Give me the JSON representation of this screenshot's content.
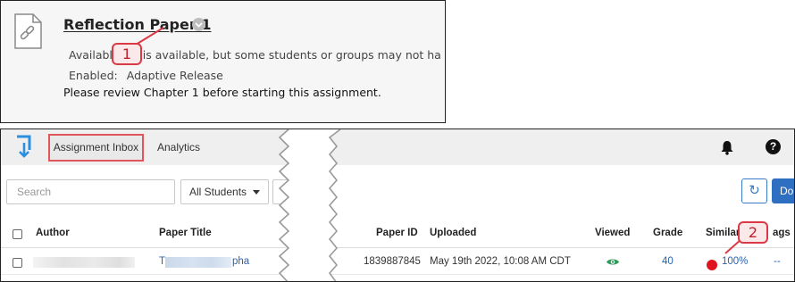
{
  "item": {
    "title": "Reflection Paper 1",
    "availability_visible": "Availabl",
    "availability_hidden_text": "em is available, but some students or groups may not ha",
    "enabled_label": "Enabled:",
    "enabled_value": "Adaptive Release",
    "description": "Please review Chapter 1 before starting this assignment."
  },
  "callouts": {
    "one": "1",
    "two": "2"
  },
  "nav": {
    "tab_inbox": "Assignment Inbox",
    "tab_analytics": "Analytics",
    "help_glyph": "?"
  },
  "toolbar": {
    "search_placeholder": "Search",
    "students_filter": "All Students",
    "refresh_glyph": "↻",
    "download_label": "Do"
  },
  "table": {
    "headers": {
      "author": "Author",
      "paper_title": "Paper Title",
      "paper_id": "Paper ID",
      "uploaded": "Uploaded",
      "viewed": "Viewed",
      "grade": "Grade",
      "similarity": "Similar",
      "flags": "ags"
    },
    "rows": [
      {
        "title_initial": "T",
        "title_tail": "pha",
        "paper_id": "1839887845",
        "uploaded": "May 19th 2022, 10:08 AM CDT",
        "grade": "40",
        "similarity": "100%",
        "flags": "--"
      }
    ]
  },
  "icons": [
    "attachment-file-icon",
    "options-chevron-icon",
    "turnitin-logo-icon",
    "bell-icon",
    "help-icon",
    "refresh-icon",
    "eye-icon",
    "similarity-dot-icon"
  ],
  "colors": {
    "callout_red": "#d93a45",
    "link_blue": "#2a63b0",
    "primary_blue": "#2e6fc2",
    "similarity_red": "#e0141e",
    "viewed_green": "#2e9a5a"
  }
}
